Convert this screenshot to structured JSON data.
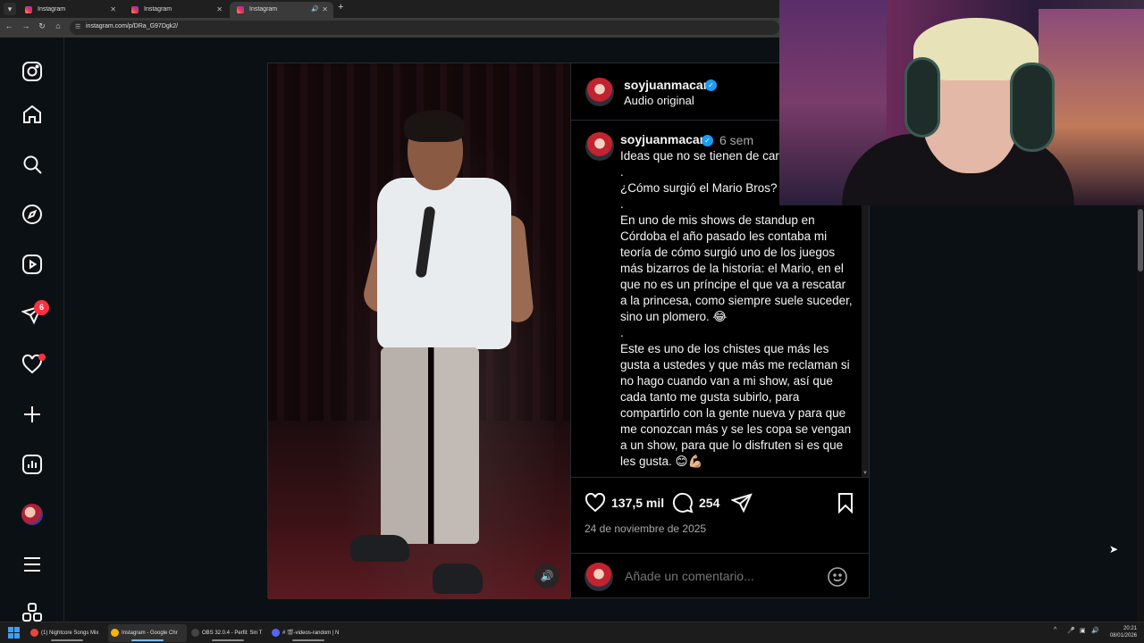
{
  "browser": {
    "tabs": [
      {
        "label": "Instagram"
      },
      {
        "label": "Instagram"
      },
      {
        "label": "Instagram"
      }
    ],
    "new_tab_icon": "plus-icon",
    "url": "instagram.com/p/DRa_G97Dgk2/"
  },
  "sidebar": {
    "items": [
      {
        "name": "instagram-logo-icon"
      },
      {
        "name": "home-icon"
      },
      {
        "name": "search-icon"
      },
      {
        "name": "explore-icon"
      },
      {
        "name": "reels-icon"
      },
      {
        "name": "messages-icon"
      },
      {
        "name": "notifications-icon"
      },
      {
        "name": "create-icon"
      },
      {
        "name": "dashboard-icon"
      },
      {
        "name": "profile-avatar"
      },
      {
        "name": "more-menu-icon"
      },
      {
        "name": "also-from-meta-icon"
      }
    ],
    "messages_badge": "6"
  },
  "post": {
    "username": "soyjuanmacar",
    "audio": "Audio original",
    "time_ago": "6 sem",
    "caption": "Ideas que no se tienen de car\n.\n¿Cómo surgió el Mario Bros?\n.\nEn uno de mis shows de standup en Córdoba el año pasado les contaba mi teoría de cómo surgió uno de los juegos más bizarros de la historia: el Mario, en el que no es un príncipe el que va a rescatar a la princesa, como siempre suele suceder, sino un plomero. 😂\n.\nEste es uno de los chistes que más les gusta a ustedes y que más me reclaman si no hago cuando van a mi show, así que cada tanto me gusta subirlo, para compartirlo con la gente nueva y para que me conozcan más y se les copa se vengan a un show, para que lo disfruten si es que les gusta. 😊💪🏼",
    "likes": "137,5 mil",
    "comments": "254",
    "date": "24 de noviembre de 2025",
    "comment_placeholder": "Añade un comentario..."
  },
  "taskbar": {
    "items": [
      {
        "label": "(1) Nightcore Songs Mix",
        "color": "#e8453c"
      },
      {
        "label": "Instagram - Google Chr",
        "color": "#f4b400"
      },
      {
        "label": "OBS 32.0.4 - Perfil: Sin T",
        "color": "#444444"
      },
      {
        "label": "# 🎬-videos-random | N",
        "color": "#5865f2"
      }
    ],
    "clock_time": "20:21",
    "clock_date": "08/01/2026"
  },
  "colors": {
    "background": "#0b1014",
    "accent_badge": "#ff3040",
    "verified": "#1d9bf0"
  }
}
